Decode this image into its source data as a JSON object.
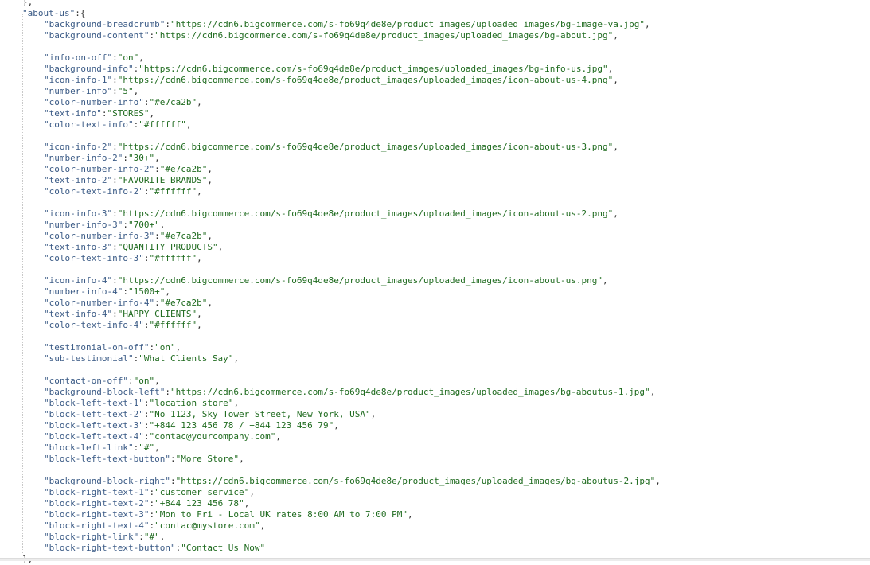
{
  "header_line": "},",
  "object_key": "about-us",
  "closing_line": "},",
  "groups": [
    [
      {
        "key": "background-breadcrumb",
        "value": "https://cdn6.bigcommerce.com/s-fo69q4de8e/product_images/uploaded_images/bg-image-va.jpg",
        "comma": true
      },
      {
        "key": "background-content",
        "value": "https://cdn6.bigcommerce.com/s-fo69q4de8e/product_images/uploaded_images/bg-about.jpg",
        "comma": true
      }
    ],
    [
      {
        "key": "info-on-off",
        "value": "on",
        "comma": true
      },
      {
        "key": "background-info",
        "value": "https://cdn6.bigcommerce.com/s-fo69q4de8e/product_images/uploaded_images/bg-info-us.jpg",
        "comma": true
      },
      {
        "key": "icon-info-1",
        "value": "https://cdn6.bigcommerce.com/s-fo69q4de8e/product_images/uploaded_images/icon-about-us-4.png",
        "comma": true
      },
      {
        "key": "number-info",
        "value": "5",
        "comma": true
      },
      {
        "key": "color-number-info",
        "value": "#e7ca2b",
        "comma": true
      },
      {
        "key": "text-info",
        "value": "STORES",
        "comma": true
      },
      {
        "key": "color-text-info",
        "value": "#ffffff",
        "comma": true
      }
    ],
    [
      {
        "key": "icon-info-2",
        "value": "https://cdn6.bigcommerce.com/s-fo69q4de8e/product_images/uploaded_images/icon-about-us-3.png",
        "comma": true
      },
      {
        "key": "number-info-2",
        "value": "30+",
        "comma": true
      },
      {
        "key": "color-number-info-2",
        "value": "#e7ca2b",
        "comma": true
      },
      {
        "key": "text-info-2",
        "value": "FAVORITE BRANDS",
        "comma": true
      },
      {
        "key": "color-text-info-2",
        "value": "#ffffff",
        "comma": true
      }
    ],
    [
      {
        "key": "icon-info-3",
        "value": "https://cdn6.bigcommerce.com/s-fo69q4de8e/product_images/uploaded_images/icon-about-us-2.png",
        "comma": true
      },
      {
        "key": "number-info-3",
        "value": "700+",
        "comma": true
      },
      {
        "key": "color-number-info-3",
        "value": "#e7ca2b",
        "comma": true
      },
      {
        "key": "text-info-3",
        "value": "QUANTITY PRODUCTS",
        "comma": true
      },
      {
        "key": "color-text-info-3",
        "value": "#ffffff",
        "comma": true
      }
    ],
    [
      {
        "key": "icon-info-4",
        "value": "https://cdn6.bigcommerce.com/s-fo69q4de8e/product_images/uploaded_images/icon-about-us.png",
        "comma": true
      },
      {
        "key": "number-info-4",
        "value": "1500+",
        "comma": true
      },
      {
        "key": "color-number-info-4",
        "value": "#e7ca2b",
        "comma": true
      },
      {
        "key": "text-info-4",
        "value": "HAPPY CLIENTS",
        "comma": true
      },
      {
        "key": "color-text-info-4",
        "value": "#ffffff",
        "comma": true
      }
    ],
    [
      {
        "key": "testimonial-on-off",
        "value": "on",
        "comma": true
      },
      {
        "key": "sub-testimonial",
        "value": "What Clients Say",
        "comma": true
      }
    ],
    [
      {
        "key": "contact-on-off",
        "value": "on",
        "comma": true
      },
      {
        "key": "background-block-left",
        "value": "https://cdn6.bigcommerce.com/s-fo69q4de8e/product_images/uploaded_images/bg-aboutus-1.jpg",
        "comma": true
      },
      {
        "key": "block-left-text-1",
        "value": "location store",
        "comma": true
      },
      {
        "key": "block-left-text-2",
        "value": "No 1123, Sky Tower Street, New York, USA",
        "comma": true
      },
      {
        "key": "block-left-text-3",
        "value": "+844 123 456 78 / +844 123 456 79",
        "comma": true
      },
      {
        "key": "block-left-text-4",
        "value": "contac@yourcompany.com",
        "comma": true
      },
      {
        "key": "block-left-link",
        "value": "#",
        "comma": true
      },
      {
        "key": "block-left-text-button",
        "value": "More Store",
        "comma": true
      }
    ],
    [
      {
        "key": "background-block-right",
        "value": "https://cdn6.bigcommerce.com/s-fo69q4de8e/product_images/uploaded_images/bg-aboutus-2.jpg",
        "comma": true
      },
      {
        "key": "block-right-text-1",
        "value": "customer service",
        "comma": true
      },
      {
        "key": "block-right-text-2",
        "value": "+844 123 456 78",
        "comma": true
      },
      {
        "key": "block-right-text-3",
        "value": "Mon to Fri - Local UK rates 8:00 AM to 7:00 PM",
        "comma": true
      },
      {
        "key": "block-right-text-4",
        "value": "contac@mystore.com",
        "comma": true
      },
      {
        "key": "block-right-link",
        "value": "#",
        "comma": true
      },
      {
        "key": "block-right-text-button",
        "value": "Contact Us Now",
        "comma": false
      }
    ]
  ]
}
